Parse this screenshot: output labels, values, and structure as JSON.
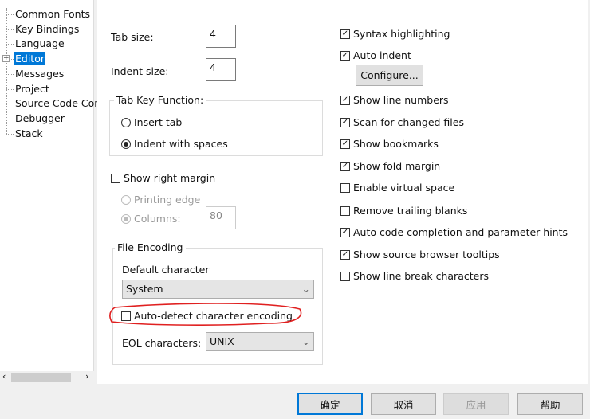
{
  "tree": {
    "items": [
      "Common Fonts",
      "Key Bindings",
      "Language",
      "Editor",
      "Messages",
      "Project",
      "Source Code Con",
      "Debugger",
      "Stack"
    ],
    "selected": "Editor"
  },
  "editor": {
    "tab_size_label": "Tab size:",
    "tab_size": "4",
    "indent_size_label": "Indent size:",
    "indent_size": "4",
    "tab_key_group": "Tab Key Function:",
    "insert_tab": "Insert tab",
    "indent_spaces": "Indent with spaces",
    "tab_key_selected": "Indent with spaces",
    "show_right_margin": "Show right margin",
    "show_right_margin_checked": false,
    "printing_edge": "Printing edge",
    "columns": "Columns:",
    "columns_value": "80",
    "file_encoding_group": "File Encoding",
    "default_character": "Default character",
    "default_character_value": "System",
    "auto_detect": "Auto-detect character encoding",
    "auto_detect_checked": false,
    "eol_label": "EOL characters:",
    "eol_value": "UNIX",
    "configure": "Configure...",
    "options": [
      {
        "label": "Syntax highlighting",
        "checked": true
      },
      {
        "label": "Auto indent",
        "checked": true
      },
      {
        "label": "Show line numbers",
        "checked": true
      },
      {
        "label": "Scan for changed files",
        "checked": true
      },
      {
        "label": "Show bookmarks",
        "checked": true
      },
      {
        "label": "Show fold margin",
        "checked": true
      },
      {
        "label": "Enable virtual space",
        "checked": false
      },
      {
        "label": "Remove trailing blanks",
        "checked": false
      },
      {
        "label": "Auto code completion and parameter hints",
        "checked": true
      },
      {
        "label": "Show source browser tooltips",
        "checked": true
      },
      {
        "label": "Show line break characters",
        "checked": false
      }
    ]
  },
  "buttons": {
    "ok": "确定",
    "cancel": "取消",
    "apply": "应用",
    "help": "帮助"
  },
  "colors": {
    "selection": "#0078d7",
    "annotation": "#e02020",
    "ok_border": "#0078d7"
  }
}
